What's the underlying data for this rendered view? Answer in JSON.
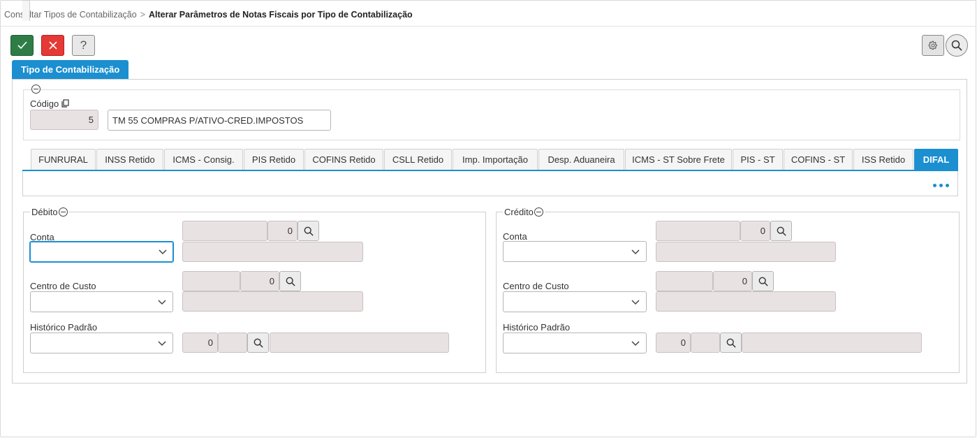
{
  "breadcrumb": {
    "parent": "Consultar Tipos de Contabilização",
    "separator": ">",
    "current": "Alterar Parâmetros de Notas Fiscais por Tipo de Contabilização"
  },
  "toolbar": {
    "help_label": "?"
  },
  "section_tab": "Tipo de Contabilização",
  "codigo": {
    "label": "Código",
    "number": "5",
    "description": "TM 55 COMPRAS P/ATIVO-CRED.IMPOSTOS"
  },
  "tabs": [
    {
      "label": "FUNRURAL"
    },
    {
      "label": "INSS Retido"
    },
    {
      "label": "ICMS - Consig."
    },
    {
      "label": "PIS Retido"
    },
    {
      "label": "COFINS Retido"
    },
    {
      "label": "CSLL Retido"
    },
    {
      "label": "Imp. Importação"
    },
    {
      "label": "Desp. Aduaneira"
    },
    {
      "label": "ICMS - ST Sobre Frete"
    },
    {
      "label": "PIS - ST"
    },
    {
      "label": "COFINS - ST"
    },
    {
      "label": "ISS Retido"
    },
    {
      "label": "DIFAL",
      "active": true
    }
  ],
  "debito": {
    "legend": "Débito",
    "conta": {
      "label": "Conta",
      "code": "0",
      "select_value": ""
    },
    "centro_custo": {
      "label": "Centro de Custo",
      "code": "0",
      "select_value": ""
    },
    "historico": {
      "label": "Histórico Padrão",
      "code": "0",
      "select_value": ""
    }
  },
  "credito": {
    "legend": "Crédito",
    "conta": {
      "label": "Conta",
      "code": "0",
      "select_value": ""
    },
    "centro_custo": {
      "label": "Centro de Custo",
      "code": "0",
      "select_value": ""
    },
    "historico": {
      "label": "Histórico Padrão",
      "code": "0",
      "select_value": ""
    }
  },
  "colors": {
    "accent": "#1b8fd0",
    "confirm": "#2e7d46",
    "cancel": "#e53935",
    "readonly_bg": "#e9e2e2"
  },
  "icons": {
    "confirm": "check-icon",
    "cancel": "close-icon",
    "help": "help-icon",
    "settings": "gear-icon",
    "search": "search-icon",
    "copy": "copy-icon",
    "collapse": "collapse-icon",
    "dropdown": "chevron-down-icon",
    "more": "more-icon"
  }
}
